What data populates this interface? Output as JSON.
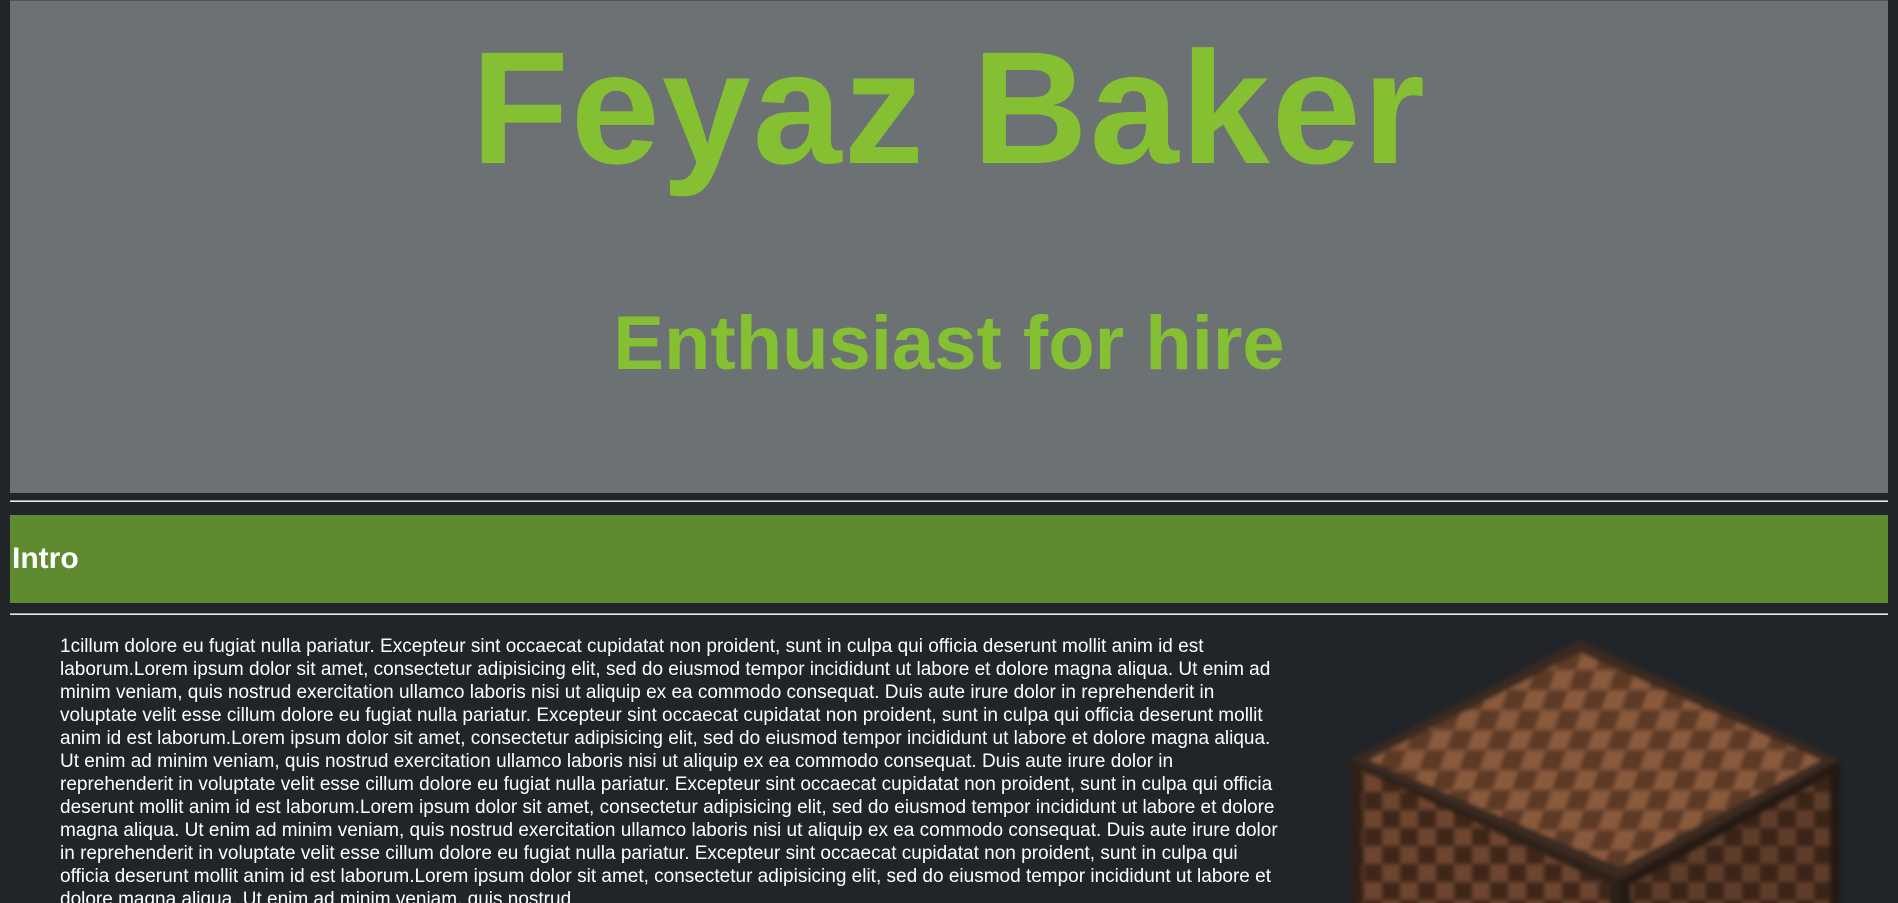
{
  "hero": {
    "name": "Feyaz Baker",
    "tagline": "Enthusiast for hire"
  },
  "intro": {
    "title": "Intro",
    "body": "1cillum dolore eu fugiat nulla pariatur. Excepteur sint occaecat cupidatat non proident, sunt in culpa qui officia deserunt mollit anim id est laborum.Lorem ipsum dolor sit amet, consectetur adipisicing elit, sed do eiusmod tempor incididunt ut labore et dolore magna aliqua. Ut enim ad minim veniam, quis nostrud exercitation ullamco laboris nisi ut aliquip ex ea commodo consequat. Duis aute irure dolor in reprehenderit in voluptate velit esse cillum dolore eu fugiat nulla pariatur. Excepteur sint occaecat cupidatat non proident, sunt in culpa qui officia deserunt mollit anim id est laborum.Lorem ipsum dolor sit amet, consectetur adipisicing elit, sed do eiusmod tempor incididunt ut labore et dolore magna aliqua. Ut enim ad minim veniam, quis nostrud exercitation ullamco laboris nisi ut aliquip ex ea commodo consequat. Duis aute irure dolor in reprehenderit in voluptate velit esse cillum dolore eu fugiat nulla pariatur. Excepteur sint occaecat cupidatat non proident, sunt in culpa qui officia deserunt mollit anim id est laborum.Lorem ipsum dolor sit amet, consectetur adipisicing elit, sed do eiusmod tempor incididunt ut labore et dolore magna aliqua. Ut enim ad minim veniam, quis nostrud exercitation ullamco laboris nisi ut aliquip ex ea commodo consequat. Duis aute irure dolor in reprehenderit in voluptate velit esse cillum dolore eu fugiat nulla pariatur. Excepteur sint occaecat cupidatat non proident, sunt in culpa qui officia deserunt mollit anim id est laborum.Lorem ipsum dolor sit amet, consectetur adipisicing elit, sed do eiusmod tempor incididunt ut labore et dolore magna aliqua. Ut enim ad minim veniam, quis nostrud",
    "image_icon": "note-block-image"
  },
  "colors": {
    "accent": "#84c032",
    "hero_background": "#6c7174",
    "section_bar": "#5e8b2f",
    "page_background": "#212529"
  }
}
